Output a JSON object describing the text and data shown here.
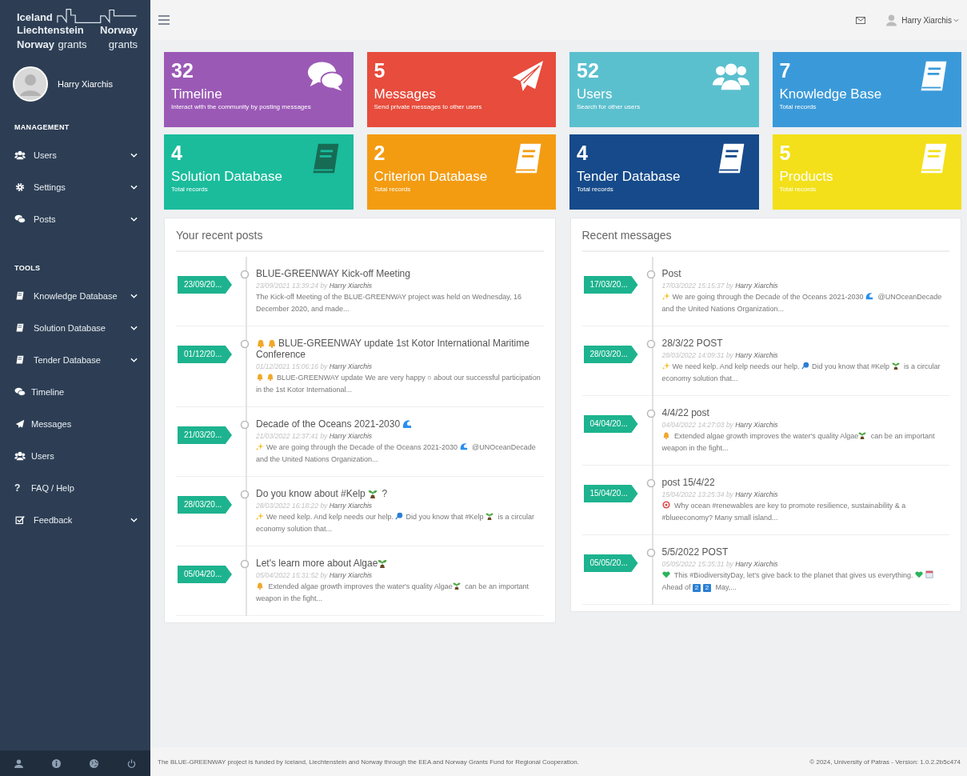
{
  "logo": {
    "lines": [
      [
        "Iceland"
      ],
      [
        "Liechtenstein",
        "Norway"
      ],
      [
        "Norway",
        "grants",
        "grants"
      ]
    ]
  },
  "profile": {
    "name": "Harry Xiarchis"
  },
  "sidebar": {
    "sections": [
      {
        "heading": "MANAGEMENT",
        "items": [
          {
            "label": "Users",
            "expandable": true
          },
          {
            "label": "Settings",
            "expandable": true
          },
          {
            "label": "Posts",
            "expandable": true
          }
        ]
      },
      {
        "heading": "TOOLS",
        "items": [
          {
            "label": "Knowledge Database",
            "expandable": true
          },
          {
            "label": "Solution Database",
            "expandable": true
          },
          {
            "label": "Tender Database",
            "expandable": true
          },
          {
            "label": "Timeline",
            "expandable": false
          },
          {
            "label": "Messages",
            "expandable": false
          },
          {
            "label": "Users",
            "expandable": false
          },
          {
            "label": "FAQ / Help",
            "expandable": false,
            "glyph": "?"
          },
          {
            "label": "Feedback",
            "expandable": true
          }
        ]
      }
    ]
  },
  "topbar": {
    "user": "Harry Xiarchis"
  },
  "tiles": [
    {
      "count": "32",
      "title": "Timeline",
      "subtitle": "Interact with the community by posting messages",
      "color": "#9b59b6"
    },
    {
      "count": "5",
      "title": "Messages",
      "subtitle": "Send private messages to other users",
      "color": "#e74c3c"
    },
    {
      "count": "52",
      "title": "Users",
      "subtitle": "Search for other users",
      "color": "#5bc0ce"
    },
    {
      "count": "7",
      "title": "Knowledge Base",
      "subtitle": "Total records",
      "color": "#3a9ad9"
    },
    {
      "count": "4",
      "title": "Solution Database",
      "subtitle": "Total records",
      "color": "#1abc9c"
    },
    {
      "count": "2",
      "title": "Criterion Database",
      "subtitle": "Total records",
      "color": "#f39c12"
    },
    {
      "count": "4",
      "title": "Tender Database",
      "subtitle": "Total records",
      "color": "#164a8a"
    },
    {
      "count": "5",
      "title": "Products",
      "subtitle": "Total records",
      "color": "#f3e01a"
    }
  ],
  "panels": [
    {
      "title": "Your recent posts",
      "entries": [
        {
          "date": "23/09/20...",
          "title": [
            {
              "kind": "text",
              "text": "BLUE-GREENWAY Kick-off Meeting"
            }
          ],
          "timestamp": "23/09/2021 13:39:24",
          "by": "by",
          "author": "Harry Xiarchis",
          "excerpt": [
            {
              "kind": "text",
              "text": "The Kick-off Meeting of the BLUE-GREENWAY project was held on Wednesday, 16 December 2020, and made..."
            }
          ]
        },
        {
          "date": "01/12/20...",
          "title": [
            {
              "kind": "bell"
            },
            {
              "kind": "bell"
            },
            {
              "kind": "text",
              "text": "BLUE-GREENWAY update 1st Kotor International Maritime Conference"
            }
          ],
          "timestamp": "01/12/2021 15:06:16",
          "by": "by",
          "author": "Harry Xiarchis",
          "excerpt": [
            {
              "kind": "bell"
            },
            {
              "kind": "bell"
            },
            {
              "kind": "text",
              "text": "BLUE-GREENWAY update We are very happy ○ about our successful participation in the 1st Kotor International..."
            }
          ]
        },
        {
          "date": "21/03/20...",
          "title": [
            {
              "kind": "text",
              "text": "Decade of the Oceans 2021-2030 "
            },
            {
              "kind": "wave"
            }
          ],
          "timestamp": "21/03/2022 12:37:41",
          "by": "by",
          "author": "Harry Xiarchis",
          "excerpt": [
            {
              "kind": "sparkle"
            },
            {
              "kind": "text",
              "text": "We are going through the Decade of the Oceans 2021-2030 "
            },
            {
              "kind": "wave"
            },
            {
              "kind": "text",
              "text": " @UNOceanDecade and the United Nations Organization..."
            }
          ]
        },
        {
          "date": "28/03/20...",
          "title": [
            {
              "kind": "text",
              "text": "Do you know about #Kelp "
            },
            {
              "kind": "sprout"
            },
            {
              "kind": "text",
              "text": " ?"
            }
          ],
          "timestamp": "28/03/2022 16:18:22",
          "by": "by",
          "author": "Harry Xiarchis",
          "excerpt": [
            {
              "kind": "sparkle"
            },
            {
              "kind": "text",
              "text": "We need kelp. And kelp needs our help. "
            },
            {
              "kind": "pin"
            },
            {
              "kind": "text",
              "text": "Did you know that #Kelp "
            },
            {
              "kind": "sprout"
            },
            {
              "kind": "text",
              "text": " is a circular economy solution that..."
            }
          ]
        },
        {
          "date": "05/04/20...",
          "title": [
            {
              "kind": "text",
              "text": "Let's learn more about Algae"
            },
            {
              "kind": "sprout"
            }
          ],
          "timestamp": "05/04/2022 15:31:52",
          "by": "by",
          "author": "Harry Xiarchis",
          "excerpt": [
            {
              "kind": "bell"
            },
            {
              "kind": "text",
              "text": " Extended algae growth improves the water's quality Algae"
            },
            {
              "kind": "sprout"
            },
            {
              "kind": "text",
              "text": " can be an important weapon in the fight..."
            }
          ]
        }
      ]
    },
    {
      "title": "Recent messages",
      "entries": [
        {
          "date": "17/03/20...",
          "title": [
            {
              "kind": "text",
              "text": "Post"
            }
          ],
          "timestamp": "17/03/2022 15:15:37",
          "by": "by",
          "author": "Harry Xiarchis",
          "excerpt": [
            {
              "kind": "sparkle"
            },
            {
              "kind": "text",
              "text": "We are going through the Decade of the Oceans 2021-2030 "
            },
            {
              "kind": "wave"
            },
            {
              "kind": "text",
              "text": " @UNOceanDecade and the United Nations Organization..."
            }
          ]
        },
        {
          "date": "28/03/20...",
          "title": [
            {
              "kind": "text",
              "text": "28/3/22 POST"
            }
          ],
          "timestamp": "28/03/2022 14:09:31",
          "by": "by",
          "author": "Harry Xiarchis",
          "excerpt": [
            {
              "kind": "sparkle"
            },
            {
              "kind": "text",
              "text": "We need kelp. And kelp needs our help. "
            },
            {
              "kind": "pin"
            },
            {
              "kind": "text",
              "text": "Did you know that #Kelp "
            },
            {
              "kind": "sprout"
            },
            {
              "kind": "text",
              "text": " is a circular economy solution that..."
            }
          ]
        },
        {
          "date": "04/04/20...",
          "title": [
            {
              "kind": "text",
              "text": "4/4/22 post"
            }
          ],
          "timestamp": "04/04/2022 14:27:03",
          "by": "by",
          "author": "Harry Xiarchis",
          "excerpt": [
            {
              "kind": "bell"
            },
            {
              "kind": "text",
              "text": " Extended algae growth improves the water's quality Algae"
            },
            {
              "kind": "sprout"
            },
            {
              "kind": "text",
              "text": " can be an important weapon in the fight..."
            }
          ]
        },
        {
          "date": "15/04/20...",
          "title": [
            {
              "kind": "text",
              "text": "post 15/4/22"
            }
          ],
          "timestamp": "15/04/2022 13:25:34",
          "by": "by",
          "author": "Harry Xiarchis",
          "excerpt": [
            {
              "kind": "target"
            },
            {
              "kind": "text",
              "text": " Why ocean #renewables are key to promote resilience, sustainability & a #blueeconomy? Many small island..."
            }
          ]
        },
        {
          "date": "05/05/20...",
          "title": [
            {
              "kind": "text",
              "text": "5/5/2022 POST"
            }
          ],
          "timestamp": "05/05/2022 15:35:31",
          "by": "by",
          "author": "Harry Xiarchis",
          "excerpt": [
            {
              "kind": "heart"
            },
            {
              "kind": "text",
              "text": " This #BiodiversityDay, let's give back to the planet that gives us everything. "
            },
            {
              "kind": "heart"
            },
            {
              "kind": "calendar"
            },
            {
              "kind": "text",
              "text": "Ahead of "
            },
            {
              "kind": "keycap",
              "text": "2"
            },
            {
              "kind": "keycap",
              "text": "2"
            },
            {
              "kind": "text",
              "text": " May,..."
            }
          ]
        }
      ]
    }
  ],
  "footer": {
    "left": "The BLUE-GREENWAY project is funded by Iceland, Liechtenstein and Norway through the EEA and Norway Grants Fund for Regional Cooperation.",
    "right": "© 2024, University of Patras - Version: 1.0.2.2b5c474"
  }
}
